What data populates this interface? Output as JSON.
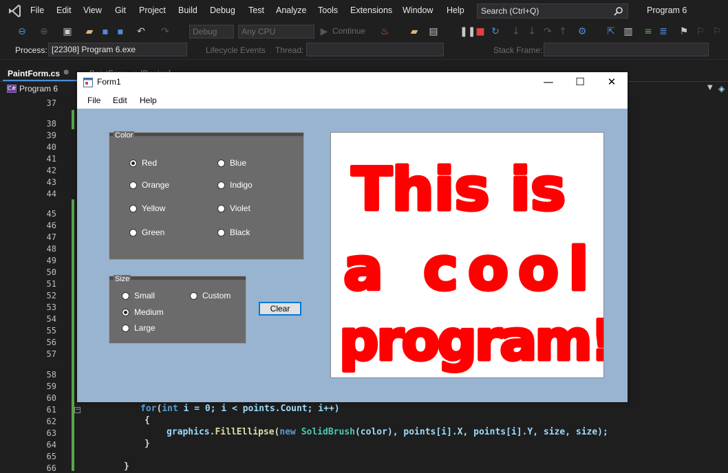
{
  "vs": {
    "menu": [
      "File",
      "Edit",
      "View",
      "Git",
      "Project",
      "Build",
      "Debug",
      "Test",
      "Analyze",
      "Tools",
      "Extensions",
      "Window",
      "Help"
    ],
    "search_text": "Search (Ctrl+Q)",
    "solution_name": "Program 6",
    "toolbar": {
      "config": "Debug",
      "platform": "Any CPU",
      "continue_label": "Continue"
    },
    "debugbar": {
      "process_label": "Process:",
      "process_value": "[22308] Program 6.exe",
      "lifecycle_label": "Lifecycle Events",
      "thread_label": "Thread:",
      "stackframe_label": "Stack Frame:"
    },
    "tabs": {
      "active": "PaintForm.cs",
      "pin": "⊕",
      "inactive": "PaintForm.cs [Design]"
    },
    "nav": {
      "project": "Program 6"
    },
    "editor": {
      "line_numbers": [
        "37",
        "38",
        "39",
        "40",
        "41",
        "42",
        "43",
        "44",
        "45",
        "46",
        "47",
        "48",
        "49",
        "50",
        "51",
        "52",
        "53",
        "54",
        "55",
        "56",
        "57",
        "58",
        "59",
        "60",
        "61",
        "62",
        "63",
        "64",
        "65",
        "66"
      ],
      "code": {
        "line61_kw": "for",
        "line61_a": "(",
        "line61_int": "int",
        "line61_b": " i = 0; i < points.Count; i++)",
        "line62": "{",
        "line63_graphics": "graphics",
        "line63_fill": ".FillEllipse(",
        "line63_new": "new",
        "line63_brush": "SolidBrush",
        "line63_rest": "(color), points[i].X, points[i].Y, size, size);",
        "line64": "}",
        "line66": "}"
      }
    }
  },
  "form": {
    "title": "Form1",
    "menu": [
      "File",
      "Edit",
      "Help"
    ],
    "color_group": {
      "legend": "Color",
      "options": [
        {
          "label": "Red",
          "checked": true
        },
        {
          "label": "Blue",
          "checked": false
        },
        {
          "label": "Orange",
          "checked": false
        },
        {
          "label": "Indigo",
          "checked": false
        },
        {
          "label": "Yellow",
          "checked": false
        },
        {
          "label": "Violet",
          "checked": false
        },
        {
          "label": "Green",
          "checked": false
        },
        {
          "label": "Black",
          "checked": false
        }
      ]
    },
    "size_group": {
      "legend": "Size",
      "options": [
        {
          "label": "Small",
          "checked": false
        },
        {
          "label": "Custom",
          "checked": false
        },
        {
          "label": "Medium",
          "checked": true
        },
        {
          "label": "Large",
          "checked": false
        }
      ]
    },
    "clear_label": "Clear",
    "canvas_text": [
      "This is",
      "a cool",
      "program!"
    ],
    "ink_color": "#ff0000"
  }
}
